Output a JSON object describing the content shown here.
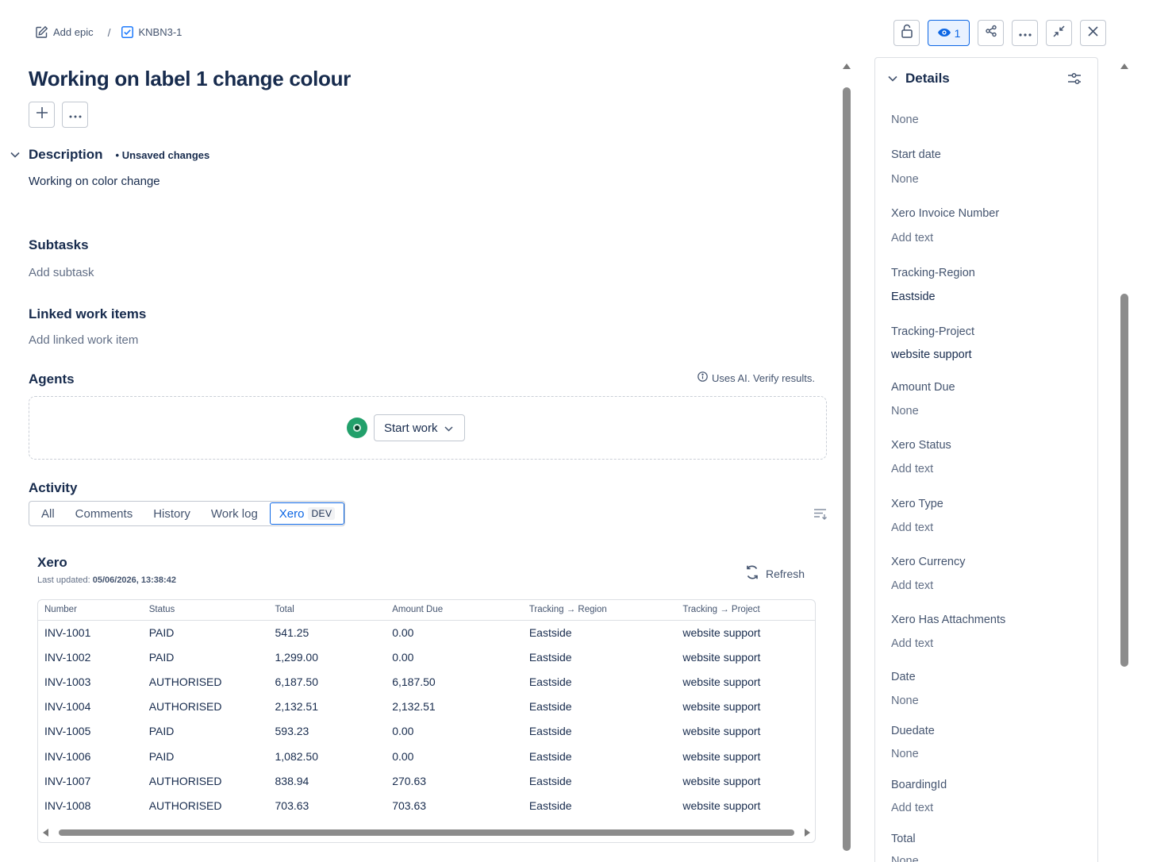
{
  "breadcrumb": {
    "epic_label": "Add epic",
    "separator": "/",
    "issue_key": "KNBN3-1"
  },
  "toolbar": {
    "watch_count": "1"
  },
  "issue": {
    "title": "Working on label 1 change colour",
    "description_heading": "Description",
    "unsaved": "• Unsaved changes",
    "description_text": "Working on color change"
  },
  "subtasks": {
    "heading": "Subtasks",
    "add_label": "Add subtask"
  },
  "linked": {
    "heading": "Linked work items",
    "add_label": "Add linked work item"
  },
  "agents": {
    "heading": "Agents",
    "ai_note": "Uses AI. Verify results.",
    "start_work_label": "Start work"
  },
  "activity": {
    "heading": "Activity",
    "tabs": [
      "All",
      "Comments",
      "History",
      "Work log",
      "Xero"
    ],
    "dev_badge": "DEV"
  },
  "xero": {
    "title": "Xero",
    "updated_label": "Last updated:",
    "updated_value": "05/06/2026, 13:38:42",
    "refresh_label": "Refresh",
    "columns": [
      "Number",
      "Status",
      "Total",
      "Amount Due",
      "Tracking → Region",
      "Tracking → Project"
    ],
    "rows": [
      [
        "INV-1001",
        "PAID",
        "541.25",
        "0.00",
        "Eastside",
        "website support"
      ],
      [
        "INV-1002",
        "PAID",
        "1,299.00",
        "0.00",
        "Eastside",
        "website support"
      ],
      [
        "INV-1003",
        "AUTHORISED",
        "6,187.50",
        "6,187.50",
        "Eastside",
        "website support"
      ],
      [
        "INV-1004",
        "AUTHORISED",
        "2,132.51",
        "2,132.51",
        "Eastside",
        "website support"
      ],
      [
        "INV-1005",
        "PAID",
        "593.23",
        "0.00",
        "Eastside",
        "website support"
      ],
      [
        "INV-1006",
        "PAID",
        "1,082.50",
        "0.00",
        "Eastside",
        "website support"
      ],
      [
        "INV-1007",
        "AUTHORISED",
        "838.94",
        "270.63",
        "Eastside",
        "website support"
      ],
      [
        "INV-1008",
        "AUTHORISED",
        "703.63",
        "703.63",
        "Eastside",
        "website support"
      ]
    ]
  },
  "details": {
    "heading": "Details",
    "top_value": "None",
    "fields": [
      {
        "label": "Start date",
        "value": "None"
      },
      {
        "label": "Xero Invoice Number",
        "value": "Add text"
      },
      {
        "label": "Tracking-Region",
        "value": "Eastside"
      },
      {
        "label": "Tracking-Project",
        "value": "website support"
      },
      {
        "label": "Amount Due",
        "value": "None"
      },
      {
        "label": "Xero Status",
        "value": "Add text"
      },
      {
        "label": "Xero Type",
        "value": "Add text"
      },
      {
        "label": "Xero Currency",
        "value": "Add text"
      },
      {
        "label": "Xero Has Attachments",
        "value": "Add text"
      },
      {
        "label": "Date",
        "value": "None"
      },
      {
        "label": "Duedate",
        "value": "None"
      },
      {
        "label": "BoardingId",
        "value": "Add text"
      },
      {
        "label": "Total",
        "value": "None"
      }
    ]
  },
  "colors": {
    "accent": "#0c66e4",
    "agent": "#22a06b",
    "text": "#172b4d",
    "muted": "#626f86"
  },
  "icons": [
    "edit-icon",
    "checkbox-icon",
    "lock-icon",
    "eye-icon",
    "share-icon",
    "more-icon",
    "collapse-icon",
    "close-icon",
    "plus-icon",
    "chevron-down-icon",
    "info-icon",
    "refresh-icon",
    "sort-icon",
    "settings-icon"
  ]
}
